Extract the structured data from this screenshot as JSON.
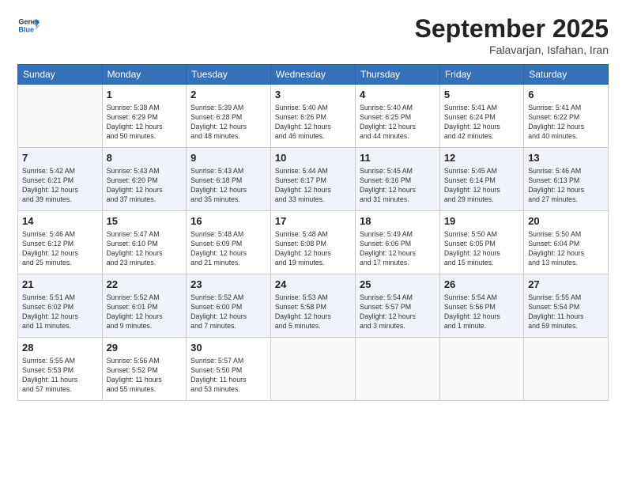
{
  "logo": {
    "line1": "General",
    "line2": "Blue"
  },
  "title": "September 2025",
  "location": "Falavarjan, Isfahan, Iran",
  "days_of_week": [
    "Sunday",
    "Monday",
    "Tuesday",
    "Wednesday",
    "Thursday",
    "Friday",
    "Saturday"
  ],
  "weeks": [
    [
      {
        "day": "",
        "info": ""
      },
      {
        "day": "1",
        "info": "Sunrise: 5:38 AM\nSunset: 6:29 PM\nDaylight: 12 hours\nand 50 minutes."
      },
      {
        "day": "2",
        "info": "Sunrise: 5:39 AM\nSunset: 6:28 PM\nDaylight: 12 hours\nand 48 minutes."
      },
      {
        "day": "3",
        "info": "Sunrise: 5:40 AM\nSunset: 6:26 PM\nDaylight: 12 hours\nand 46 minutes."
      },
      {
        "day": "4",
        "info": "Sunrise: 5:40 AM\nSunset: 6:25 PM\nDaylight: 12 hours\nand 44 minutes."
      },
      {
        "day": "5",
        "info": "Sunrise: 5:41 AM\nSunset: 6:24 PM\nDaylight: 12 hours\nand 42 minutes."
      },
      {
        "day": "6",
        "info": "Sunrise: 5:41 AM\nSunset: 6:22 PM\nDaylight: 12 hours\nand 40 minutes."
      }
    ],
    [
      {
        "day": "7",
        "info": "Sunrise: 5:42 AM\nSunset: 6:21 PM\nDaylight: 12 hours\nand 39 minutes."
      },
      {
        "day": "8",
        "info": "Sunrise: 5:43 AM\nSunset: 6:20 PM\nDaylight: 12 hours\nand 37 minutes."
      },
      {
        "day": "9",
        "info": "Sunrise: 5:43 AM\nSunset: 6:18 PM\nDaylight: 12 hours\nand 35 minutes."
      },
      {
        "day": "10",
        "info": "Sunrise: 5:44 AM\nSunset: 6:17 PM\nDaylight: 12 hours\nand 33 minutes."
      },
      {
        "day": "11",
        "info": "Sunrise: 5:45 AM\nSunset: 6:16 PM\nDaylight: 12 hours\nand 31 minutes."
      },
      {
        "day": "12",
        "info": "Sunrise: 5:45 AM\nSunset: 6:14 PM\nDaylight: 12 hours\nand 29 minutes."
      },
      {
        "day": "13",
        "info": "Sunrise: 5:46 AM\nSunset: 6:13 PM\nDaylight: 12 hours\nand 27 minutes."
      }
    ],
    [
      {
        "day": "14",
        "info": "Sunrise: 5:46 AM\nSunset: 6:12 PM\nDaylight: 12 hours\nand 25 minutes."
      },
      {
        "day": "15",
        "info": "Sunrise: 5:47 AM\nSunset: 6:10 PM\nDaylight: 12 hours\nand 23 minutes."
      },
      {
        "day": "16",
        "info": "Sunrise: 5:48 AM\nSunset: 6:09 PM\nDaylight: 12 hours\nand 21 minutes."
      },
      {
        "day": "17",
        "info": "Sunrise: 5:48 AM\nSunset: 6:08 PM\nDaylight: 12 hours\nand 19 minutes."
      },
      {
        "day": "18",
        "info": "Sunrise: 5:49 AM\nSunset: 6:06 PM\nDaylight: 12 hours\nand 17 minutes."
      },
      {
        "day": "19",
        "info": "Sunrise: 5:50 AM\nSunset: 6:05 PM\nDaylight: 12 hours\nand 15 minutes."
      },
      {
        "day": "20",
        "info": "Sunrise: 5:50 AM\nSunset: 6:04 PM\nDaylight: 12 hours\nand 13 minutes."
      }
    ],
    [
      {
        "day": "21",
        "info": "Sunrise: 5:51 AM\nSunset: 6:02 PM\nDaylight: 12 hours\nand 11 minutes."
      },
      {
        "day": "22",
        "info": "Sunrise: 5:52 AM\nSunset: 6:01 PM\nDaylight: 12 hours\nand 9 minutes."
      },
      {
        "day": "23",
        "info": "Sunrise: 5:52 AM\nSunset: 6:00 PM\nDaylight: 12 hours\nand 7 minutes."
      },
      {
        "day": "24",
        "info": "Sunrise: 5:53 AM\nSunset: 5:58 PM\nDaylight: 12 hours\nand 5 minutes."
      },
      {
        "day": "25",
        "info": "Sunrise: 5:54 AM\nSunset: 5:57 PM\nDaylight: 12 hours\nand 3 minutes."
      },
      {
        "day": "26",
        "info": "Sunrise: 5:54 AM\nSunset: 5:56 PM\nDaylight: 12 hours\nand 1 minute."
      },
      {
        "day": "27",
        "info": "Sunrise: 5:55 AM\nSunset: 5:54 PM\nDaylight: 11 hours\nand 59 minutes."
      }
    ],
    [
      {
        "day": "28",
        "info": "Sunrise: 5:55 AM\nSunset: 5:53 PM\nDaylight: 11 hours\nand 57 minutes."
      },
      {
        "day": "29",
        "info": "Sunrise: 5:56 AM\nSunset: 5:52 PM\nDaylight: 11 hours\nand 55 minutes."
      },
      {
        "day": "30",
        "info": "Sunrise: 5:57 AM\nSunset: 5:50 PM\nDaylight: 11 hours\nand 53 minutes."
      },
      {
        "day": "",
        "info": ""
      },
      {
        "day": "",
        "info": ""
      },
      {
        "day": "",
        "info": ""
      },
      {
        "day": "",
        "info": ""
      }
    ]
  ]
}
